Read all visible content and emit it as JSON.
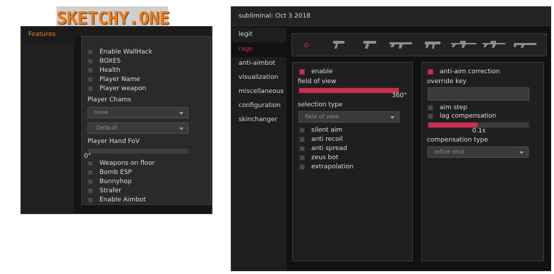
{
  "logo": {
    "text": "SKETCHY.ONE"
  },
  "window1": {
    "tab": "Features",
    "checkboxes_top": [
      "Enable WallHack",
      "BOXES",
      "Health",
      "Player Name",
      "Player weapon"
    ],
    "chams_label": "Player Chams",
    "chams_select": "none",
    "default_select": "Default",
    "fov_label": "Player Hand FoV",
    "fov_value": "0°",
    "fov_percent": 0,
    "checkboxes_bottom": [
      "Weapons on floor",
      "Bomb ESP",
      "Bunnyhop",
      "Strafer",
      "Enable Aimbot"
    ]
  },
  "window2": {
    "title": "subliminal: Oct  3 2018",
    "nav": [
      "legit",
      "rage",
      "anti-aimbot",
      "visualization",
      "miscellaneous",
      "configuration",
      "skinchanger"
    ],
    "active_nav": "rage",
    "weapon_icons": [
      "general",
      "pistol",
      "heavy-pistol",
      "rifle",
      "smg",
      "sniper",
      "auto-sniper",
      "shotgun"
    ],
    "left": {
      "enable_label": "enable",
      "fov_label": "field of view",
      "fov_value": "360°",
      "fov_percent": 100,
      "selection_label": "selection type",
      "selection_value": "field of view",
      "options": [
        "silent aim",
        "anti recoil",
        "anti spread",
        "zeus bot",
        "extrapolation"
      ]
    },
    "right": {
      "aa_label": "anti-aim correction",
      "override_label": "override key",
      "aim_step": "aim step",
      "lag_comp": "lag compensation",
      "lag_value": "0.1s",
      "lag_percent": 49,
      "comp_type_label": "compensation type",
      "comp_type_value": "refine shot"
    }
  },
  "colors": {
    "accent_orange": "#e87d1e",
    "accent_red": "#c8304c"
  }
}
